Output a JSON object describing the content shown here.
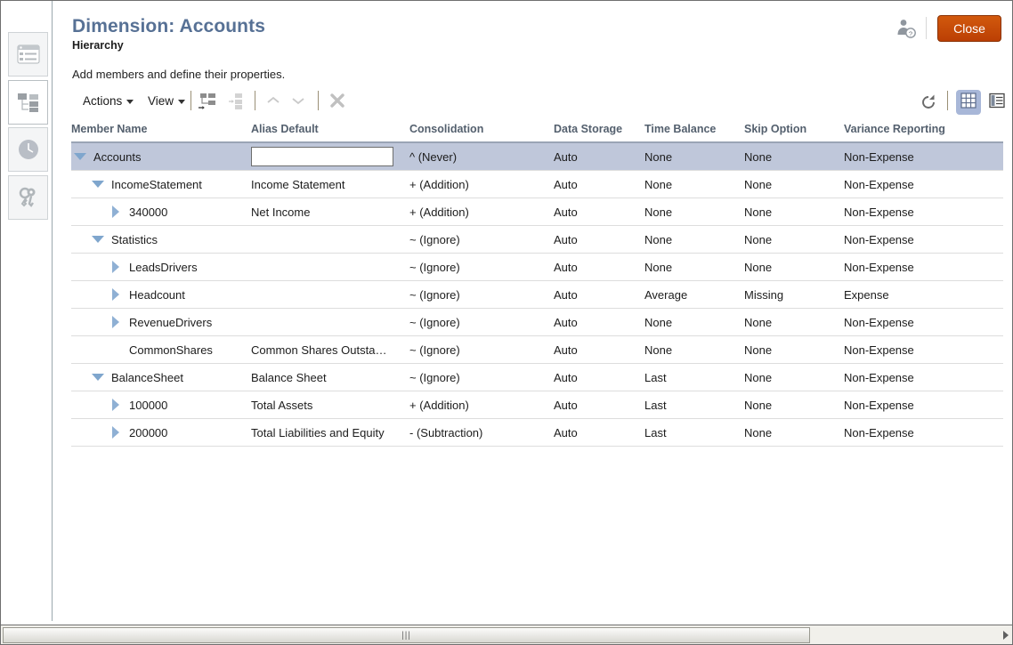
{
  "header": {
    "title": "Dimension: Accounts",
    "subtitle": "Hierarchy",
    "description": "Add members and define their properties.",
    "close_label": "Close",
    "user_icon": "user-help-icon",
    "accent_color": "#577195",
    "close_button_color": "#c24c07"
  },
  "sidebar": {
    "items": [
      {
        "name": "form-list-icon",
        "active": false
      },
      {
        "name": "dimension-hierarchy-icon",
        "active": true
      },
      {
        "name": "clock-icon",
        "active": false
      },
      {
        "name": "keys-icon",
        "active": false
      }
    ]
  },
  "toolbar": {
    "actions_label": "Actions",
    "view_label": "View",
    "icons": [
      {
        "name": "add-child-icon",
        "disabled": false
      },
      {
        "name": "add-sibling-icon",
        "disabled": true
      },
      {
        "name": "move-up-icon",
        "disabled": true
      },
      {
        "name": "move-down-icon",
        "disabled": true
      },
      {
        "name": "delete-icon",
        "disabled": false
      }
    ],
    "refresh_icon": "refresh-icon",
    "grid_view_icon": "grid-view-icon",
    "detail_view_icon": "detail-view-icon",
    "grid_view_selected": true
  },
  "grid": {
    "columns": [
      "Member Name",
      "Alias Default",
      "Consolidation",
      "Data Storage",
      "Time Balance",
      "Skip Option",
      "Variance Reporting"
    ],
    "rows": [
      {
        "member": "Accounts",
        "level": 0,
        "toggle": "expanded",
        "alias": "",
        "alias_editing": true,
        "alias_placeholder": "",
        "consolidation": "^ (Never)",
        "data_storage": "Auto",
        "time_balance": "None",
        "skip_option": "None",
        "variance_reporting": "Non-Expense",
        "selected": true
      },
      {
        "member": "IncomeStatement",
        "level": 1,
        "toggle": "expanded",
        "alias": "Income Statement",
        "alias_editing": false,
        "consolidation": "+ (Addition)",
        "data_storage": "Auto",
        "time_balance": "None",
        "skip_option": "None",
        "variance_reporting": "Non-Expense",
        "selected": false
      },
      {
        "member": "340000",
        "level": 2,
        "toggle": "collapsed",
        "alias": "Net Income",
        "alias_editing": false,
        "consolidation": "+ (Addition)",
        "data_storage": "Auto",
        "time_balance": "None",
        "skip_option": "None",
        "variance_reporting": "Non-Expense",
        "selected": false
      },
      {
        "member": "Statistics",
        "level": 1,
        "toggle": "expanded",
        "alias": "",
        "alias_editing": false,
        "consolidation": "~ (Ignore)",
        "data_storage": "Auto",
        "time_balance": "None",
        "skip_option": "None",
        "variance_reporting": "Non-Expense",
        "selected": false
      },
      {
        "member": "LeadsDrivers",
        "level": 2,
        "toggle": "collapsed",
        "alias": "",
        "alias_editing": false,
        "consolidation": "~ (Ignore)",
        "data_storage": "Auto",
        "time_balance": "None",
        "skip_option": "None",
        "variance_reporting": "Non-Expense",
        "selected": false
      },
      {
        "member": "Headcount",
        "level": 2,
        "toggle": "collapsed",
        "alias": "",
        "alias_editing": false,
        "consolidation": "~ (Ignore)",
        "data_storage": "Auto",
        "time_balance": "Average",
        "skip_option": "Missing",
        "variance_reporting": "Expense",
        "selected": false
      },
      {
        "member": "RevenueDrivers",
        "level": 2,
        "toggle": "collapsed",
        "alias": "",
        "alias_editing": false,
        "consolidation": "~ (Ignore)",
        "data_storage": "Auto",
        "time_balance": "None",
        "skip_option": "None",
        "variance_reporting": "Non-Expense",
        "selected": false
      },
      {
        "member": "CommonShares",
        "level": 2,
        "toggle": "none",
        "alias": "Common Shares Outsta…",
        "alias_editing": false,
        "consolidation": "~ (Ignore)",
        "data_storage": "Auto",
        "time_balance": "None",
        "skip_option": "None",
        "variance_reporting": "Non-Expense",
        "selected": false
      },
      {
        "member": "BalanceSheet",
        "level": 1,
        "toggle": "expanded",
        "alias": "Balance Sheet",
        "alias_editing": false,
        "consolidation": "~ (Ignore)",
        "data_storage": "Auto",
        "time_balance": "Last",
        "skip_option": "None",
        "variance_reporting": "Non-Expense",
        "selected": false
      },
      {
        "member": "100000",
        "level": 2,
        "toggle": "collapsed",
        "alias": "Total Assets",
        "alias_editing": false,
        "consolidation": "+ (Addition)",
        "data_storage": "Auto",
        "time_balance": "Last",
        "skip_option": "None",
        "variance_reporting": "Non-Expense",
        "selected": false
      },
      {
        "member": "200000",
        "level": 2,
        "toggle": "collapsed",
        "alias": "Total Liabilities and Equity",
        "alias_editing": false,
        "consolidation": "- (Subtraction)",
        "data_storage": "Auto",
        "time_balance": "Last",
        "skip_option": "None",
        "variance_reporting": "Non-Expense",
        "selected": false
      }
    ]
  },
  "scrollbar": {
    "grip": "|||",
    "right_arrow": "scroll-right-arrow-icon"
  }
}
